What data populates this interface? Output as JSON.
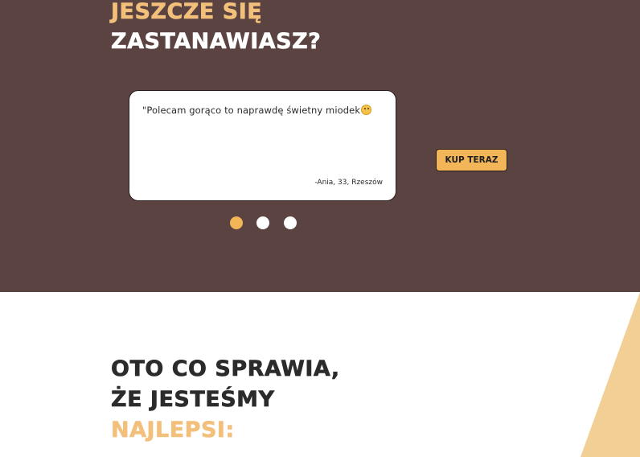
{
  "hero": {
    "title_line1": "Jeszcze się",
    "title_line2": "zastanawiasz?",
    "background_color": "#5b4341"
  },
  "testimonial": {
    "quote": "\"Polecam gorąco to naprawdę świetny miodek",
    "emoji_icon": "grinning-face-emoji",
    "author": "-Ania, 33, Rzeszów"
  },
  "carousel": {
    "slide_count": 3,
    "active_index": 0
  },
  "buy_button": {
    "label": "KUP TERAZ",
    "color": "#f2b659"
  },
  "features": {
    "title_line1": "Oto co sprawia,",
    "title_line2": "że jesteśmy",
    "title_line3": "najlepsi:",
    "accent_color": "#f2c07b"
  }
}
